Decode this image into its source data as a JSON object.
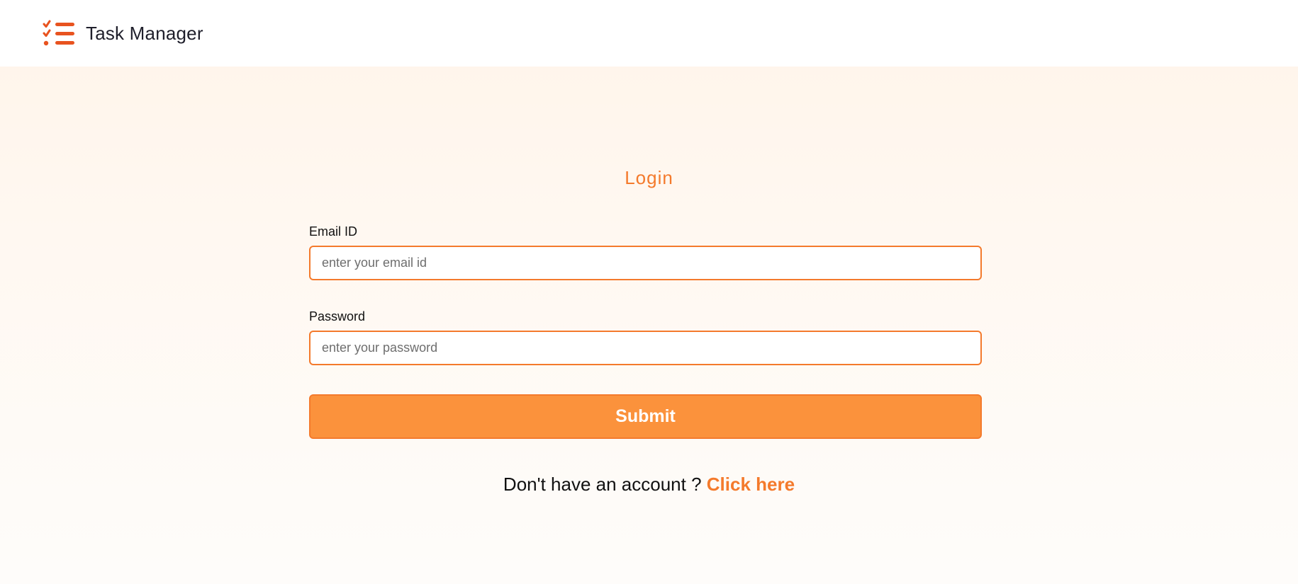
{
  "navbar": {
    "app_title": "Task Manager",
    "logo_icon": "checklist-icon"
  },
  "login": {
    "title": "Login",
    "email": {
      "label": "Email ID",
      "placeholder": "enter your email id",
      "value": ""
    },
    "password": {
      "label": "Password",
      "placeholder": "enter your password",
      "value": ""
    },
    "submit_label": "Submit",
    "signup_prompt": "Don't have an account ?",
    "signup_link": "Click here"
  },
  "colors": {
    "accent": "#f47a2c",
    "button_fill": "#fb923c",
    "icon": "#e8531f"
  }
}
